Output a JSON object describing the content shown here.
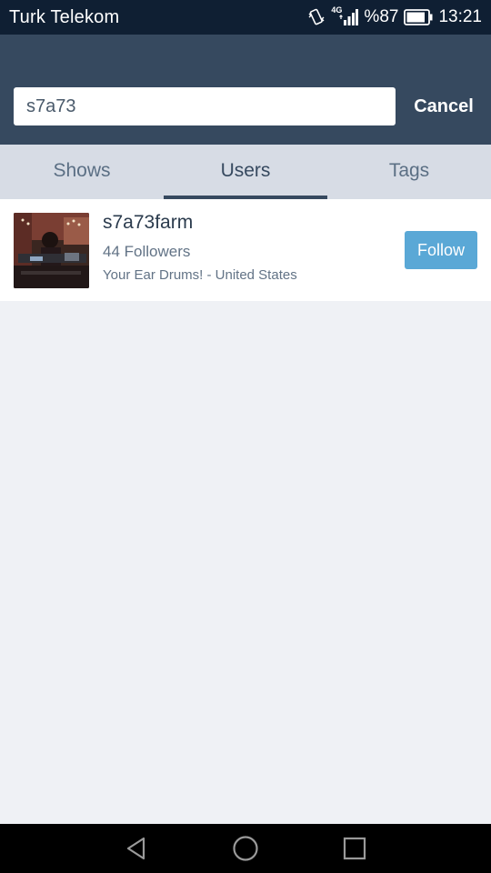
{
  "status_bar": {
    "carrier": "Turk Telekom",
    "network": "4G",
    "battery": "%87",
    "time": "13:21",
    "icons": [
      "vibrate-icon",
      "signal-icon",
      "battery-icon"
    ]
  },
  "search": {
    "value": "s7a73",
    "cancel_label": "Cancel"
  },
  "tabs": [
    {
      "label": "Shows",
      "active": false
    },
    {
      "label": "Users",
      "active": true
    },
    {
      "label": "Tags",
      "active": false
    }
  ],
  "results": [
    {
      "name": "s7a73farm",
      "followers": "44 Followers",
      "tagline": "Your Ear Drums! - United States",
      "follow_label": "Follow"
    }
  ],
  "colors": {
    "status_bar": "#0f1f33",
    "header": "#36495f",
    "tabs_bg": "#d7dce5",
    "follow_button": "#5aa8d6",
    "background": "#eff1f5"
  },
  "nav_bar": {
    "icons": [
      "back-icon",
      "home-icon",
      "recents-icon"
    ]
  }
}
